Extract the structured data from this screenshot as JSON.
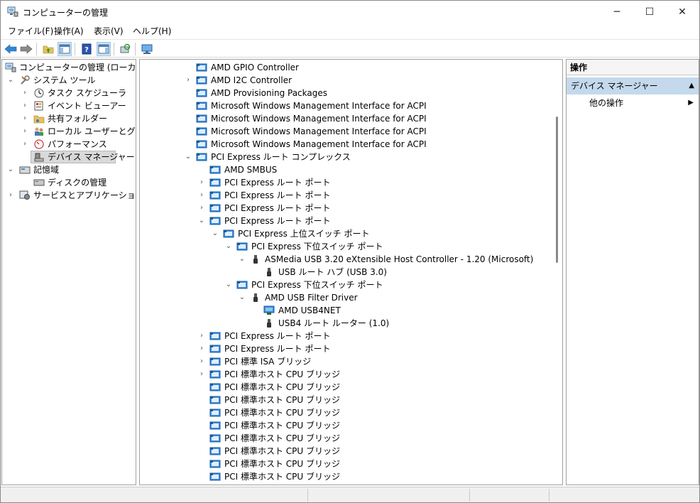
{
  "window": {
    "title": "コンピューターの管理",
    "minimize_glyph": "─",
    "maximize_glyph": "☐",
    "close_glyph": "✕"
  },
  "menu": [
    "ファイル(F)",
    "操作(A)",
    "表示(V)",
    "ヘルプ(H)"
  ],
  "toolbar": {
    "icons": [
      "back-arrow-icon",
      "forward-arrow-icon",
      "up-folder-icon",
      "show-hide-tree-icon",
      "help-icon",
      "show-hide-action-pane-icon",
      "scan-hardware-icon",
      "monitor-icon"
    ]
  },
  "tree": {
    "root": "コンピューターの管理 (ローカル)",
    "items": [
      {
        "label": "システム ツール",
        "icon": "tools-icon"
      },
      {
        "label": "タスク スケジューラ",
        "icon": "clock-icon"
      },
      {
        "label": "イベント ビューアー",
        "icon": "event-viewer-icon"
      },
      {
        "label": "共有フォルダー",
        "icon": "shared-folder-icon"
      },
      {
        "label": "ローカル ユーザーとグループ",
        "icon": "users-icon"
      },
      {
        "label": "パフォーマンス",
        "icon": "performance-icon"
      },
      {
        "label": "デバイス マネージャー",
        "icon": "device-manager-icon"
      },
      {
        "label": "記憶域",
        "icon": "storage-icon"
      },
      {
        "label": "ディスクの管理",
        "icon": "disk-icon"
      },
      {
        "label": "サービスとアプリケーション",
        "icon": "services-icon"
      }
    ]
  },
  "devices": [
    {
      "label": "AMD GPIO Controller",
      "icon": "system-device-icon"
    },
    {
      "label": "AMD I2C Controller",
      "icon": "system-device-icon"
    },
    {
      "label": "AMD Provisioning Packages",
      "icon": "system-device-icon"
    },
    {
      "label": "Microsoft Windows Management Interface for ACPI",
      "icon": "system-device-icon"
    },
    {
      "label": "Microsoft Windows Management Interface for ACPI",
      "icon": "system-device-icon"
    },
    {
      "label": "Microsoft Windows Management Interface for ACPI",
      "icon": "system-device-icon"
    },
    {
      "label": "Microsoft Windows Management Interface for ACPI",
      "icon": "system-device-icon"
    },
    {
      "label": "PCI Express ルート コンプレックス",
      "icon": "system-device-icon"
    },
    {
      "label": "AMD SMBUS",
      "icon": "system-device-icon"
    },
    {
      "label": "PCI Express ルート ポート",
      "icon": "system-device-icon"
    },
    {
      "label": "PCI Express ルート ポート",
      "icon": "system-device-icon"
    },
    {
      "label": "PCI Express ルート ポート",
      "icon": "system-device-icon"
    },
    {
      "label": "PCI Express ルート ポート",
      "icon": "system-device-icon"
    },
    {
      "label": "PCI Express 上位スイッチ ポート",
      "icon": "system-device-icon"
    },
    {
      "label": "PCI Express 下位スイッチ ポート",
      "icon": "system-device-icon"
    },
    {
      "label": "ASMedia USB 3.20 eXtensible Host Controller - 1.20 (Microsoft)",
      "icon": "usb-icon"
    },
    {
      "label": "USB ルート ハブ (USB 3.0)",
      "icon": "usb-icon"
    },
    {
      "label": "PCI Express 下位スイッチ ポート",
      "icon": "system-device-icon"
    },
    {
      "label": "AMD USB Filter Driver",
      "icon": "usb-icon"
    },
    {
      "label": "AMD USB4NET",
      "icon": "network-adapter-icon"
    },
    {
      "label": "USB4 ルート ルーター (1.0)",
      "icon": "usb-icon"
    },
    {
      "label": "PCI Express ルート ポート",
      "icon": "system-device-icon"
    },
    {
      "label": "PCI Express ルート ポート",
      "icon": "system-device-icon"
    },
    {
      "label": "PCI 標準 ISA ブリッジ",
      "icon": "system-device-icon"
    },
    {
      "label": "PCI 標準ホスト CPU ブリッジ",
      "icon": "system-device-icon"
    },
    {
      "label": "PCI 標準ホスト CPU ブリッジ",
      "icon": "system-device-icon"
    },
    {
      "label": "PCI 標準ホスト CPU ブリッジ",
      "icon": "system-device-icon"
    },
    {
      "label": "PCI 標準ホスト CPU ブリッジ",
      "icon": "system-device-icon"
    },
    {
      "label": "PCI 標準ホスト CPU ブリッジ",
      "icon": "system-device-icon"
    },
    {
      "label": "PCI 標準ホスト CPU ブリッジ",
      "icon": "system-device-icon"
    },
    {
      "label": "PCI 標準ホスト CPU ブリッジ",
      "icon": "system-device-icon"
    },
    {
      "label": "PCI 標準ホスト CPU ブリッジ",
      "icon": "system-device-icon"
    },
    {
      "label": "PCI 標準ホスト CPU ブリッジ",
      "icon": "system-device-icon"
    }
  ],
  "actions": {
    "header": "操作",
    "section": "デバイス マネージャー",
    "section_glyph": "▲",
    "item": "他の操作",
    "item_glyph": "▶"
  },
  "colors": {
    "selection": "#d9d9d9",
    "actions_section": "#c4d9ec",
    "device_icon_blue": "#3a8ee6"
  }
}
